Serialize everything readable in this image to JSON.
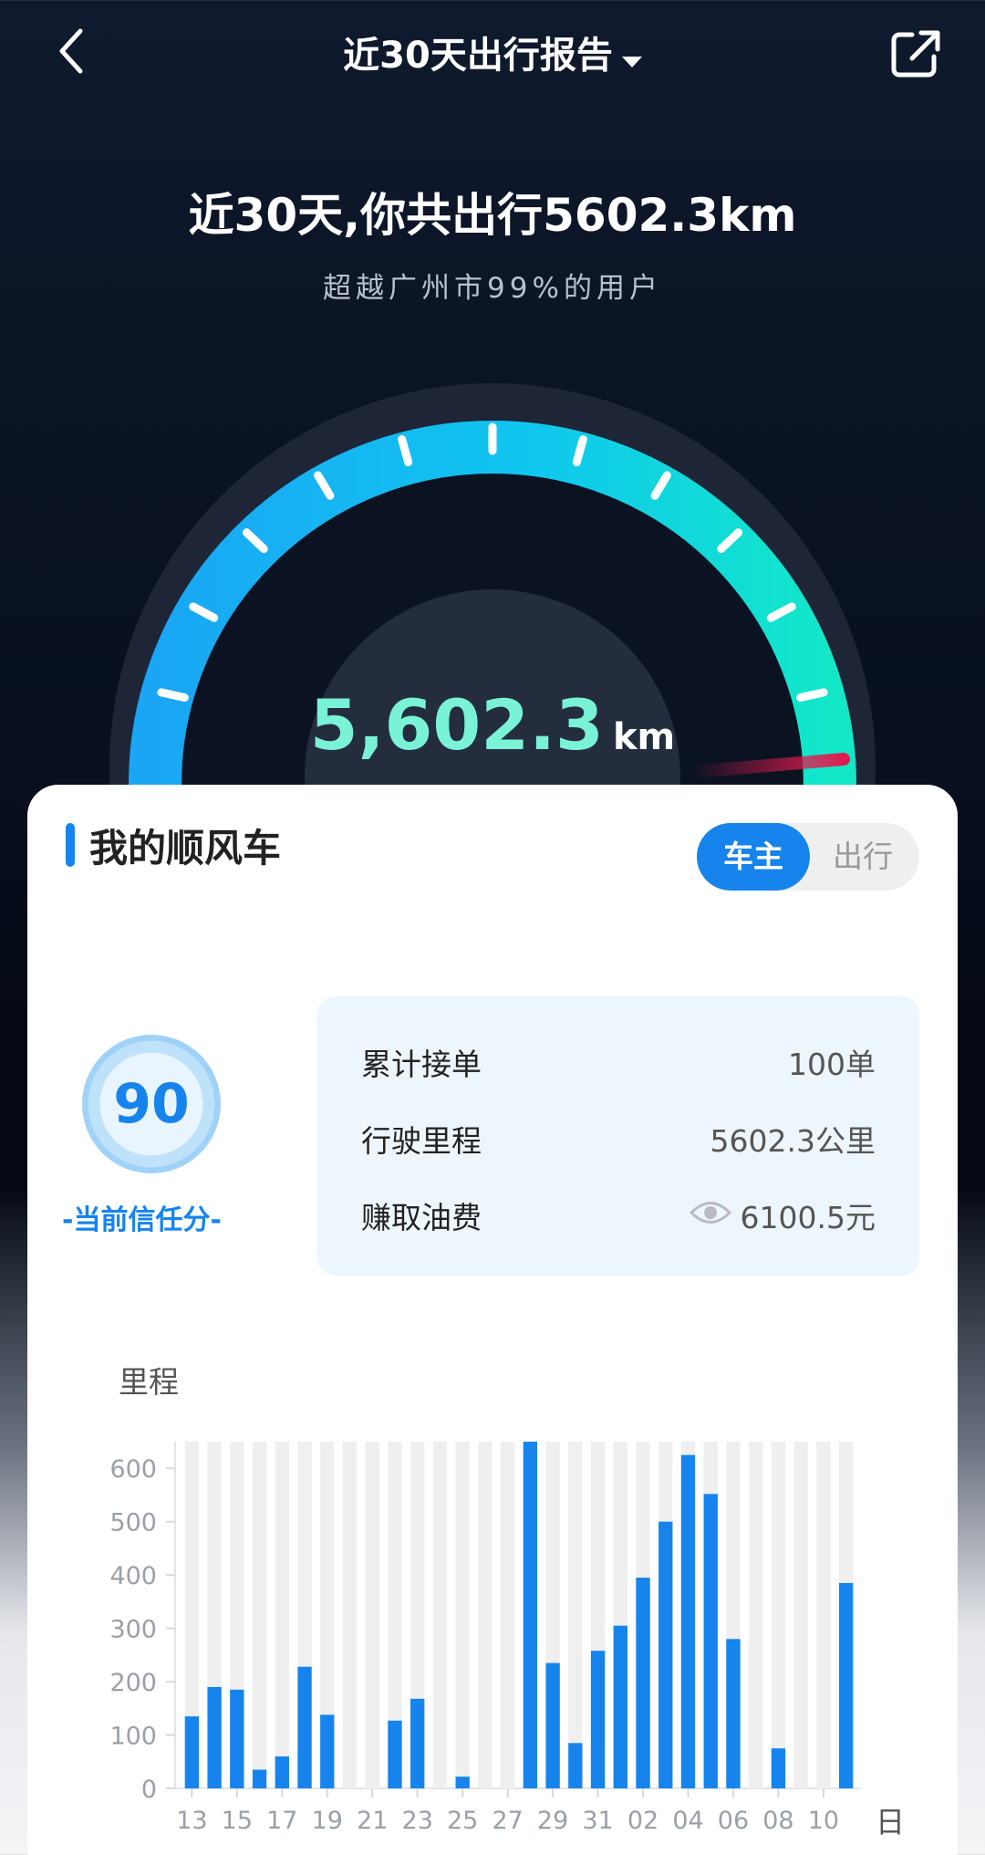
{
  "header": {
    "title": "近30天出行报告",
    "back_icon": "chevron-left-icon",
    "share_icon": "share-external-icon"
  },
  "summary": {
    "headline": "近30天,你共出行5602.3km",
    "subline": "超越广州市99%的用户"
  },
  "gauge": {
    "value": "5,602.3",
    "unit": "km",
    "colors": {
      "start": "#1aa6f5",
      "end": "#12e8c8",
      "needle": "#e01a4f"
    }
  },
  "card": {
    "title": "我的顺风车",
    "toggle": {
      "active": "车主",
      "inactive": "出行"
    },
    "score": {
      "value": "90",
      "label": "-当前信任分-"
    },
    "stats": [
      {
        "label": "累计接单",
        "value": "100单"
      },
      {
        "label": "行驶里程",
        "value": "5602.3公里"
      },
      {
        "label": "赚取油费",
        "value": "6100.5元",
        "icon": "eye-icon"
      }
    ],
    "chart_label": "里程",
    "day_unit": "日"
  },
  "chart_data": {
    "type": "bar",
    "title": "",
    "xlabel": "",
    "ylabel": "里程",
    "ylim": [
      0,
      650
    ],
    "yticks": [
      0,
      100,
      200,
      300,
      400,
      500,
      600
    ],
    "x_tick_labels": [
      "13",
      "15",
      "17",
      "19",
      "21",
      "23",
      "25",
      "27",
      "29",
      "31",
      "02",
      "04",
      "06",
      "08",
      "10"
    ],
    "categories": [
      "13",
      "14",
      "15",
      "16",
      "17",
      "18",
      "19",
      "20",
      "21",
      "22",
      "23",
      "24",
      "25",
      "26",
      "27",
      "28",
      "29",
      "30",
      "31",
      "01",
      "02",
      "03",
      "04",
      "05",
      "06",
      "07",
      "08",
      "09",
      "10",
      "11"
    ],
    "values": [
      135,
      190,
      185,
      35,
      60,
      228,
      138,
      0,
      0,
      127,
      168,
      0,
      22,
      0,
      0,
      650,
      235,
      85,
      258,
      305,
      395,
      500,
      625,
      552,
      280,
      0,
      75,
      0,
      0,
      385
    ],
    "background_bars": true,
    "colors": {
      "bar": "#1684ec",
      "track": "#efefef",
      "tick": "#9aa0a8"
    }
  }
}
